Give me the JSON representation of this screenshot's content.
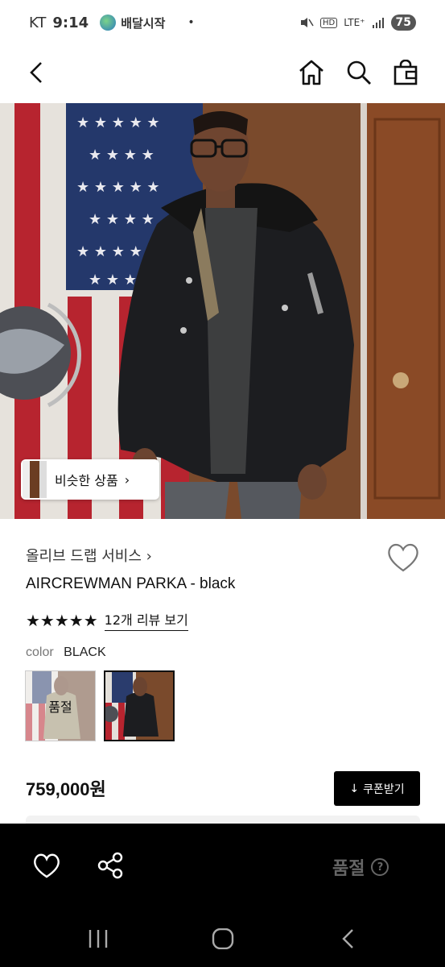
{
  "status_bar": {
    "carrier": "KT",
    "time": "9:14",
    "app_name": "배달시작",
    "dot": "•",
    "network": "LTE⁺",
    "hd": "HD",
    "battery": "75"
  },
  "nav": {
    "back_icon": "chevron-left-icon",
    "home_icon": "home-icon",
    "search_icon": "search-icon",
    "bag_icon": "shopping-bag-icon"
  },
  "hero": {
    "similar_label": "비슷한 상품",
    "similar_chevron": "›"
  },
  "product": {
    "brand": "올리브 드랩 서비스 ›",
    "name": "AIRCREWMAN PARKA - black",
    "stars": "★★★★★",
    "review_link": "12개 리뷰 보기",
    "color_label": "color",
    "color_value": "BLACK",
    "swatch_sold": "품절",
    "price": "759,000원",
    "coupon_label": "쿠폰받기",
    "coupon_icon": "↓"
  },
  "bottom_bar": {
    "soldout": "품절",
    "help": "?",
    "heart_icon": "heart-outline-icon",
    "share_icon": "share-icon"
  },
  "system_nav": {
    "recents_icon": "recents-icon",
    "home_icon": "home-circle-icon",
    "back_icon": "back-icon"
  }
}
